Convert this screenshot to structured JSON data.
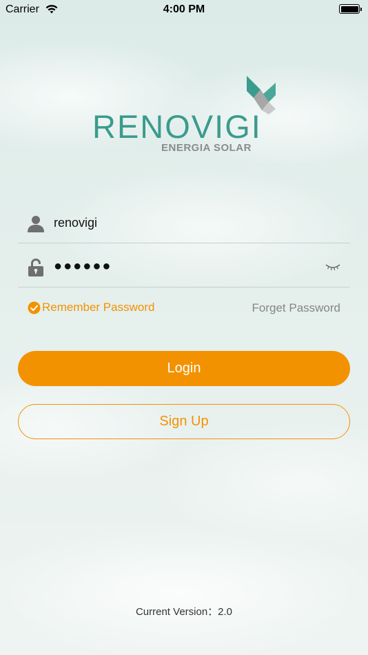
{
  "status_bar": {
    "carrier": "Carrier",
    "time": "4:00 PM"
  },
  "logo": {
    "name": "RENOVIGI",
    "tagline": "ENERGIA SOLAR"
  },
  "form": {
    "username_value": "renovigi",
    "password_value": "●●●●●●",
    "remember_label": "Remember Password",
    "forget_label": "Forget Password"
  },
  "buttons": {
    "login_label": "Login",
    "signup_label": "Sign Up"
  },
  "footer": {
    "version_text": "Current Version：2.0"
  },
  "colors": {
    "accent": "#f39200",
    "brand": "#3b9b8d",
    "muted": "#868686"
  },
  "icons": {
    "username": "user-icon",
    "password": "lock-icon",
    "visibility": "eye-closed-icon",
    "remember": "check-circle-icon"
  }
}
